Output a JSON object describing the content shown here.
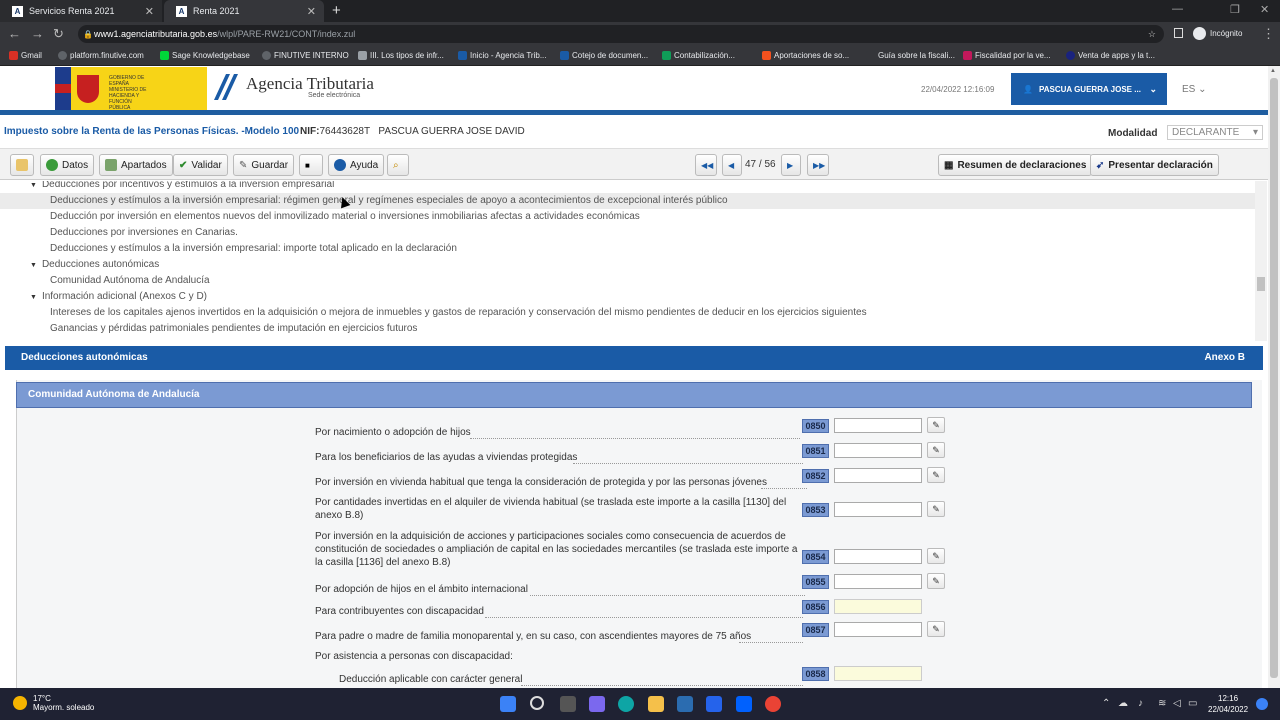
{
  "browser": {
    "tabs": [
      {
        "title": "Servicios Renta 2021"
      },
      {
        "title": "Renta 2021"
      }
    ],
    "new_tab": "+",
    "url_host": "www1.agenciatributaria.gob.es",
    "url_path": "/wlpl/PARE-RW21/CONT/index.zul",
    "profile": "Incógnito",
    "bookmarks": [
      {
        "label": "Gmail",
        "color": "#d93025"
      },
      {
        "label": "platform.finutive.com",
        "color": "#5f6368"
      },
      {
        "label": "Sage Knowledgebase",
        "color": "#00d639"
      },
      {
        "label": "FINUTIVE INTERNO",
        "color": "#5f6368"
      },
      {
        "label": "III. Los tipos de infr...",
        "color": "#9aa0a6"
      },
      {
        "label": "Inicio - Agencia Trib...",
        "color": "#1a5ba6"
      },
      {
        "label": "Cotejo de documen...",
        "color": "#1a5ba6"
      },
      {
        "label": "Contabilización...",
        "color": "#0f9d58"
      },
      {
        "label": "Aportaciones de so...",
        "color": "#f4511e"
      },
      {
        "label": "Guía sobre la fiscali...",
        "color": "#35363a"
      },
      {
        "label": "Fiscalidad por la ve...",
        "color": "#c2185b"
      },
      {
        "label": "Venta de apps y la t...",
        "color": "#1a237e"
      }
    ]
  },
  "header": {
    "gov_text": "GOBIERNO DE ESPAÑA  MINISTERIO DE HACIENDA Y FUNCIÓN PÚBLICA",
    "agency": "Agencia Tributaria",
    "agency_sub": "Sede electrónica",
    "timestamp": "22/04/2022 12:16:09",
    "user": "PASCUA GUERRA JOSE ...",
    "lang": "ES"
  },
  "title": {
    "model": "Impuesto sobre la Renta de las Personas Físicas. -Modelo 100",
    "nif_label": "NIF:",
    "nif": "76443628T",
    "name": "PASCUA GUERRA JOSE DAVID",
    "modalidad_label": "Modalidad",
    "modalidad_value": "DECLARANTE"
  },
  "toolbar": {
    "datos": "Datos",
    "apartados": "Apartados",
    "validar": "Validar",
    "guardar": "Guardar",
    "ayuda": "Ayuda",
    "page": "47 / 56",
    "resumen": "Resumen de declaraciones",
    "presentar": "Presentar declaración"
  },
  "tree": [
    {
      "text": "Deducciones por incentivos y estímulos a la inversión empresarial",
      "level": 0,
      "caret": true
    },
    {
      "text": "Deducciones y estímulos a la inversión empresarial: régimen general y regímenes especiales de apoyo a acontecimientos de excepcional interés público",
      "level": 1,
      "highlight": true
    },
    {
      "text": "Deducción por inversión en elementos nuevos del inmovilizado material o inversiones inmobiliarias afectas a actividades económicas",
      "level": 1
    },
    {
      "text": "Deducciones por inversiones en Canarias.",
      "level": 1
    },
    {
      "text": "Deducciones y estímulos a la inversión empresarial: importe total aplicado en la declaración",
      "level": 1
    },
    {
      "text": "Deducciones autonómicas",
      "level": 0,
      "caret": true
    },
    {
      "text": "Comunidad Autónoma de Andalucía",
      "level": 1
    },
    {
      "text": "Información adicional (Anexos C y D)",
      "level": 0,
      "caret": true
    },
    {
      "text": "Intereses de los capitales ajenos invertidos en la adquisición o mejora de inmuebles y gastos de reparación y conservación del mismo pendientes de deducir en los ejercicios siguientes",
      "level": 1
    },
    {
      "text": "Ganancias y pérdidas patrimoniales pendientes de imputación en ejercicios futuros",
      "level": 1
    }
  ],
  "section": {
    "title": "Deducciones autonómicas",
    "annex": "Anexo B",
    "subsection": "Comunidad Autónoma de Andalucía"
  },
  "fields": [
    {
      "label": "Por nacimiento o adopción de hijos",
      "code": "0850",
      "editable": true
    },
    {
      "label": "Para los beneficiarios de las ayudas a viviendas protegidas",
      "code": "0851",
      "editable": true
    },
    {
      "label": "Por inversión en vivienda habitual que tenga la consideración de protegida y por las personas jóvenes",
      "code": "0852",
      "editable": true
    },
    {
      "label": "Por cantidades invertidas en el alquiler de vivienda habitual (se traslada este importe a la casilla [1130] del anexo B.8)",
      "code": "0853",
      "editable": true
    },
    {
      "label": "Por inversión en la adquisición de acciones y participaciones sociales como consecuencia de acuerdos de constitución de sociedades o ampliación de capital en las sociedades mercantiles (se traslada este importe a la casilla [1136] del anexo B.8)",
      "code": "0854",
      "editable": true
    },
    {
      "label": "Por adopción de hijos en el ámbito internacional",
      "code": "0855",
      "editable": true
    },
    {
      "label": "Para contribuyentes con discapacidad",
      "code": "0856",
      "editable": false
    },
    {
      "label": "Para padre o madre de familia monoparental y, en su caso, con ascendientes mayores de 75 años",
      "code": "0857",
      "editable": true
    },
    {
      "label": "Por asistencia a personas con discapacidad:",
      "code": "",
      "editable": false
    },
    {
      "label": "Deducción aplicable con carácter general",
      "code": "0858",
      "editable": false
    }
  ],
  "taskbar": {
    "temp": "17°C",
    "weather": "Mayorm. soleado",
    "time": "12:16",
    "date": "22/04/2022"
  }
}
